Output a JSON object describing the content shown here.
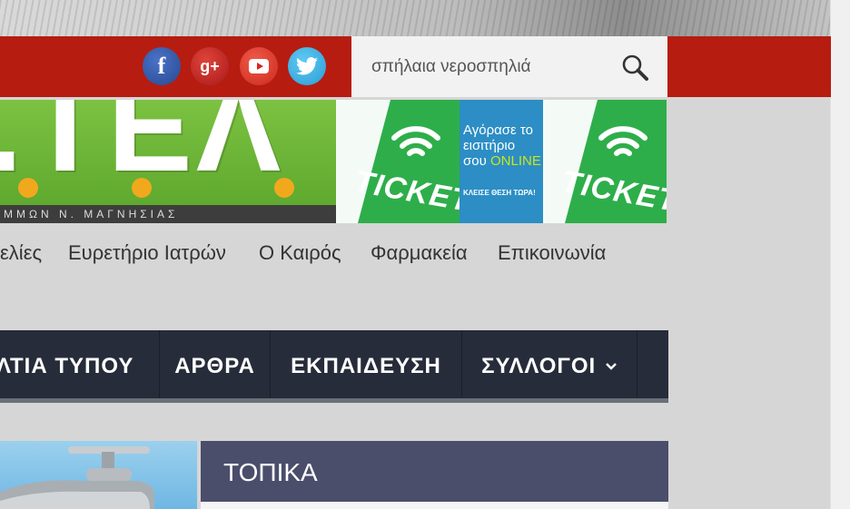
{
  "social": {
    "facebook": {
      "icon": "facebook-icon",
      "glyph": "f"
    },
    "googleplus": {
      "icon": "google-plus-icon",
      "glyph": "g+"
    },
    "youtube": {
      "icon": "youtube-icon"
    },
    "twitter": {
      "icon": "twitter-icon"
    }
  },
  "search": {
    "value": "σπήλαια νεροσπηλιά",
    "icon": "search-icon"
  },
  "banner": {
    "logo_text": ".ΤΕΛ",
    "logo_subtitle": "ΜΜΩΝ Ν. ΜΑΓΝΗΣΙΑΣ",
    "ad_word": "TICKET",
    "ad_line1": "Αγόρασε το",
    "ad_line2": "εισιτήριο",
    "ad_line3_prefix": "σου ",
    "ad_line3_online": "ONLINE",
    "ad_small": "ΚΛΕΙΣΕ ΘΕΣΗ ΤΩΡΑ!"
  },
  "links": [
    "ελίες",
    "Ευρετήριο Ιατρών",
    "Ο Καιρός",
    "Φαρμακεία",
    "Επικοινωνία"
  ],
  "nav": {
    "items": [
      "ΛΤΙΑ ΤΥΠΟΥ",
      "ΑΡΘΡΑ",
      "ΕΚΠΑΙΔΕΥΣΗ",
      "ΣΥΛΛΟΓΟΙ"
    ],
    "dropdown_icon": "chevron-down-icon"
  },
  "section": {
    "title": "ΤΟΠΙΚΑ"
  },
  "colors": {
    "red_bar": "#b71c11",
    "nav_bg": "#272c3b",
    "section_bg": "#4a4e6b",
    "banner_green": "#5aa52b"
  }
}
